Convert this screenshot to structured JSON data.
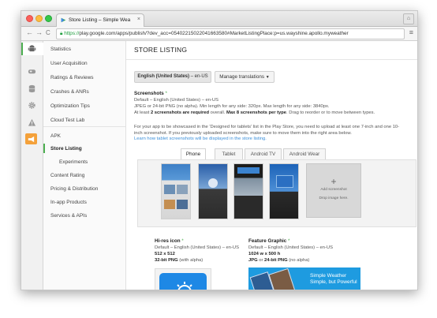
{
  "browser": {
    "tab_title": "Store Listing – Simple Wea",
    "tab_close": "×",
    "url_scheme": "https://",
    "url_rest": "play.google.com/apps/publish/?dev_acc=05402215022041663580#MarketListingPlace:p=us.wayshine.apollo.myweather",
    "back": "←",
    "forward": "→",
    "reload": "C",
    "menu": "≡"
  },
  "rail_icons": [
    "android-icon",
    "gamepad-icon",
    "database-icon",
    "gear-icon",
    "alert-icon",
    "megaphone-icon"
  ],
  "sidebar": {
    "group1": [
      "Statistics",
      "User Acquisition",
      "Ratings & Reviews",
      "Crashes & ANRs",
      "Optimization Tips",
      "Cloud Test Lab"
    ],
    "apk": "APK",
    "store_listing": "Store Listing",
    "experiments": "Experiments",
    "group2": [
      "Content Rating",
      "Pricing & Distribution",
      "In-app Products",
      "Services & APIs"
    ]
  },
  "main": {
    "title": "STORE LISTING",
    "language_button_bold": "English (United States)",
    "language_button_suffix": " – en-US",
    "manage_translations": "Manage translations",
    "dropdown_arrow": "▼",
    "screenshots": {
      "label": "Screenshots",
      "required_mark": "*",
      "lines": [
        "Default – English (United States) – en-US",
        "JPEG or 24-bit PNG (no alpha). Min length for any side: 320px. Max length for any side: 3840px."
      ],
      "line3_pre": "At least ",
      "line3_b1": "2 screenshots are required",
      "line3_mid": " overall. ",
      "line3_b2": "Max 8 screenshots per type",
      "line3_post": ". Drag to reorder or to move between types.",
      "tablet_info": [
        "For your app to be showcased in the 'Designed for tablets' list in the Play Store, you need to upload at least one 7-inch and one 10-",
        "inch screenshot. If you previously uploaded screenshots, make sure to move them into the right area below."
      ],
      "learn_link": "Learn how tablet screenshots will be displayed in the store listing.",
      "tabs": [
        "Phone",
        "Tablet",
        "Android TV",
        "Android Wear"
      ],
      "add_plus": "+",
      "add_label": "Add screenshot",
      "drop_label": "Drop image here."
    },
    "hires": {
      "label": "Hi-res icon",
      "required_mark": "*",
      "line1": "Default – English (United States) – en-US",
      "line2": "512 x 512",
      "line3_bold": "32-bit PNG",
      "line3_rest": " (with alpha)"
    },
    "feature": {
      "label": "Feature Graphic",
      "required_mark": "*",
      "line1": "Default – English (United States) – en-US",
      "line2": "1024 w x 500 h",
      "line3_b1": "JPG",
      "line3_mid": " or ",
      "line3_b2": "24-bit PNG",
      "line3_rest": " (no alpha)",
      "promo1": "Simple Weather",
      "promo2": "Simple, but Powerful"
    }
  },
  "colors": {
    "accent": "#4caf50",
    "link": "#3b8fd9",
    "brand_blue": "#1e88e5"
  }
}
